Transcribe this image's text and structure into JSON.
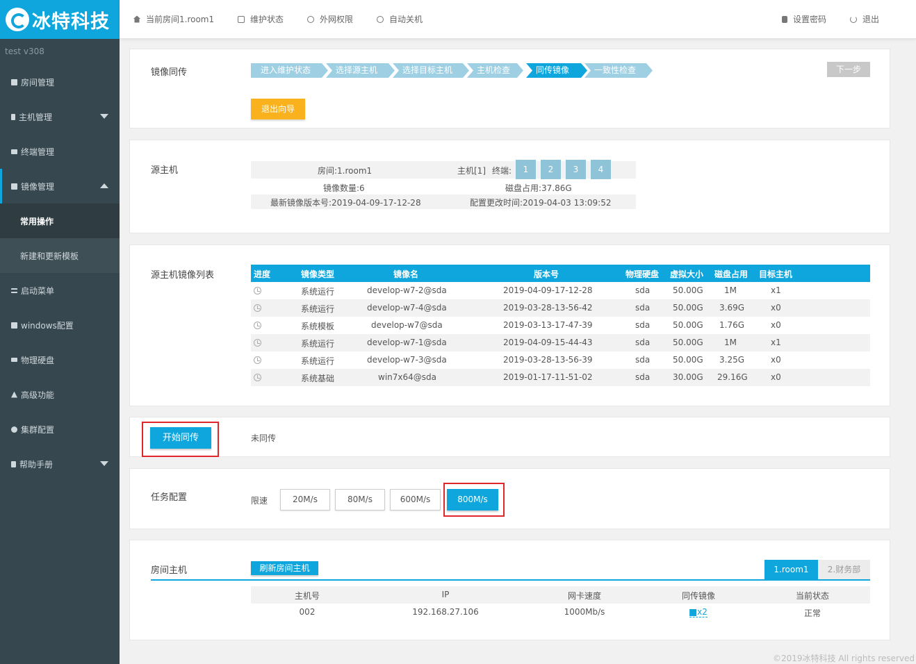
{
  "brand": {
    "name": "冰特科技"
  },
  "sidebar": {
    "version": "test  v308",
    "items": [
      {
        "label": "房间管理",
        "icon": "home-icon"
      },
      {
        "label": "主机管理",
        "icon": "server-icon"
      },
      {
        "label": "终端管理",
        "icon": "monitor-icon"
      },
      {
        "label": "镜像管理",
        "icon": "database-icon"
      },
      {
        "label": "启动菜单",
        "icon": "list-icon"
      },
      {
        "label": "windows配置",
        "icon": "windows-icon"
      },
      {
        "label": "物理硬盘",
        "icon": "harddisk-icon"
      },
      {
        "label": "高级功能",
        "icon": "warning-icon"
      },
      {
        "label": "集群配置",
        "icon": "gear-icon"
      },
      {
        "label": "帮助手册",
        "icon": "book-icon"
      }
    ],
    "sub_items": [
      "常用操作",
      "新建和更新模板"
    ]
  },
  "topbar": {
    "room": "当前房间1.room1",
    "maintenance": "维护状态",
    "network": "外网权限",
    "autoshutdown": "自动关机",
    "set_password": "设置密码",
    "logout": "退出"
  },
  "wizard": {
    "title": "镜像同传",
    "steps": [
      "进入维护状态",
      "选择源主机",
      "选择目标主机",
      "主机检查",
      "同传镜像",
      "一致性检查"
    ],
    "active_step": 4,
    "next": "下一步",
    "exit": "退出向导"
  },
  "source": {
    "title": "源主机",
    "room": "房间:1.room1",
    "host": "主机[1]",
    "terminal_label": "终端:",
    "terminals": [
      "1",
      "2",
      "3",
      "4"
    ],
    "image_count": "镜像数量:6",
    "disk_usage": "磁盘占用:37.86G",
    "latest_version": "最新镜像版本号:2019-04-09-17-12-28",
    "config_time": "配置更改时间:2019-04-03 13:09:52"
  },
  "image_list": {
    "title": "源主机镜像列表",
    "columns": [
      "进度",
      "镜像类型",
      "镜像名",
      "版本号",
      "物理硬盘",
      "虚拟大小",
      "磁盘占用",
      "目标主机"
    ],
    "rows": [
      [
        "系统运行",
        "develop-w7-2@sda",
        "2019-04-09-17-12-28",
        "sda",
        "50.00G",
        "1M",
        "x1"
      ],
      [
        "系统运行",
        "develop-w7-4@sda",
        "2019-03-28-13-56-42",
        "sda",
        "50.00G",
        "3.69G",
        "x0"
      ],
      [
        "系统模板",
        "develop-w7@sda",
        "2019-03-13-17-47-39",
        "sda",
        "50.00G",
        "1.76G",
        "x0"
      ],
      [
        "系统运行",
        "develop-w7-1@sda",
        "2019-04-09-15-44-43",
        "sda",
        "50.00G",
        "1M",
        "x1"
      ],
      [
        "系统运行",
        "develop-w7-3@sda",
        "2019-03-28-13-56-39",
        "sda",
        "50.00G",
        "3.25G",
        "x0"
      ],
      [
        "系统基础",
        "win7x64@sda",
        "2019-01-17-11-51-02",
        "sda",
        "30.00G",
        "29.16G",
        "x0"
      ]
    ]
  },
  "sync": {
    "button": "开始同传",
    "status": "未同传"
  },
  "task": {
    "title": "任务配置",
    "limit_label": "限速",
    "speeds": [
      "20M/s",
      "80M/s",
      "600M/s",
      "800M/s"
    ],
    "selected": "800M/s"
  },
  "room_hosts": {
    "title": "房间主机",
    "refresh": "刷新房间主机",
    "tabs": [
      "1.room1",
      "2.财务部"
    ],
    "columns": [
      "主机号",
      "IP",
      "网卡速度",
      "同传镜像",
      "当前状态"
    ],
    "rows": [
      [
        "002",
        "192.168.27.106",
        "1000Mb/s",
        "x2",
        "正常"
      ]
    ]
  },
  "footer": "©2019冰特科技 All rights reserved",
  "colors": {
    "accent": "#0ea6dc",
    "sidebar": "#37474f",
    "orange": "#f9b21e",
    "highlight": "#e0252b"
  }
}
